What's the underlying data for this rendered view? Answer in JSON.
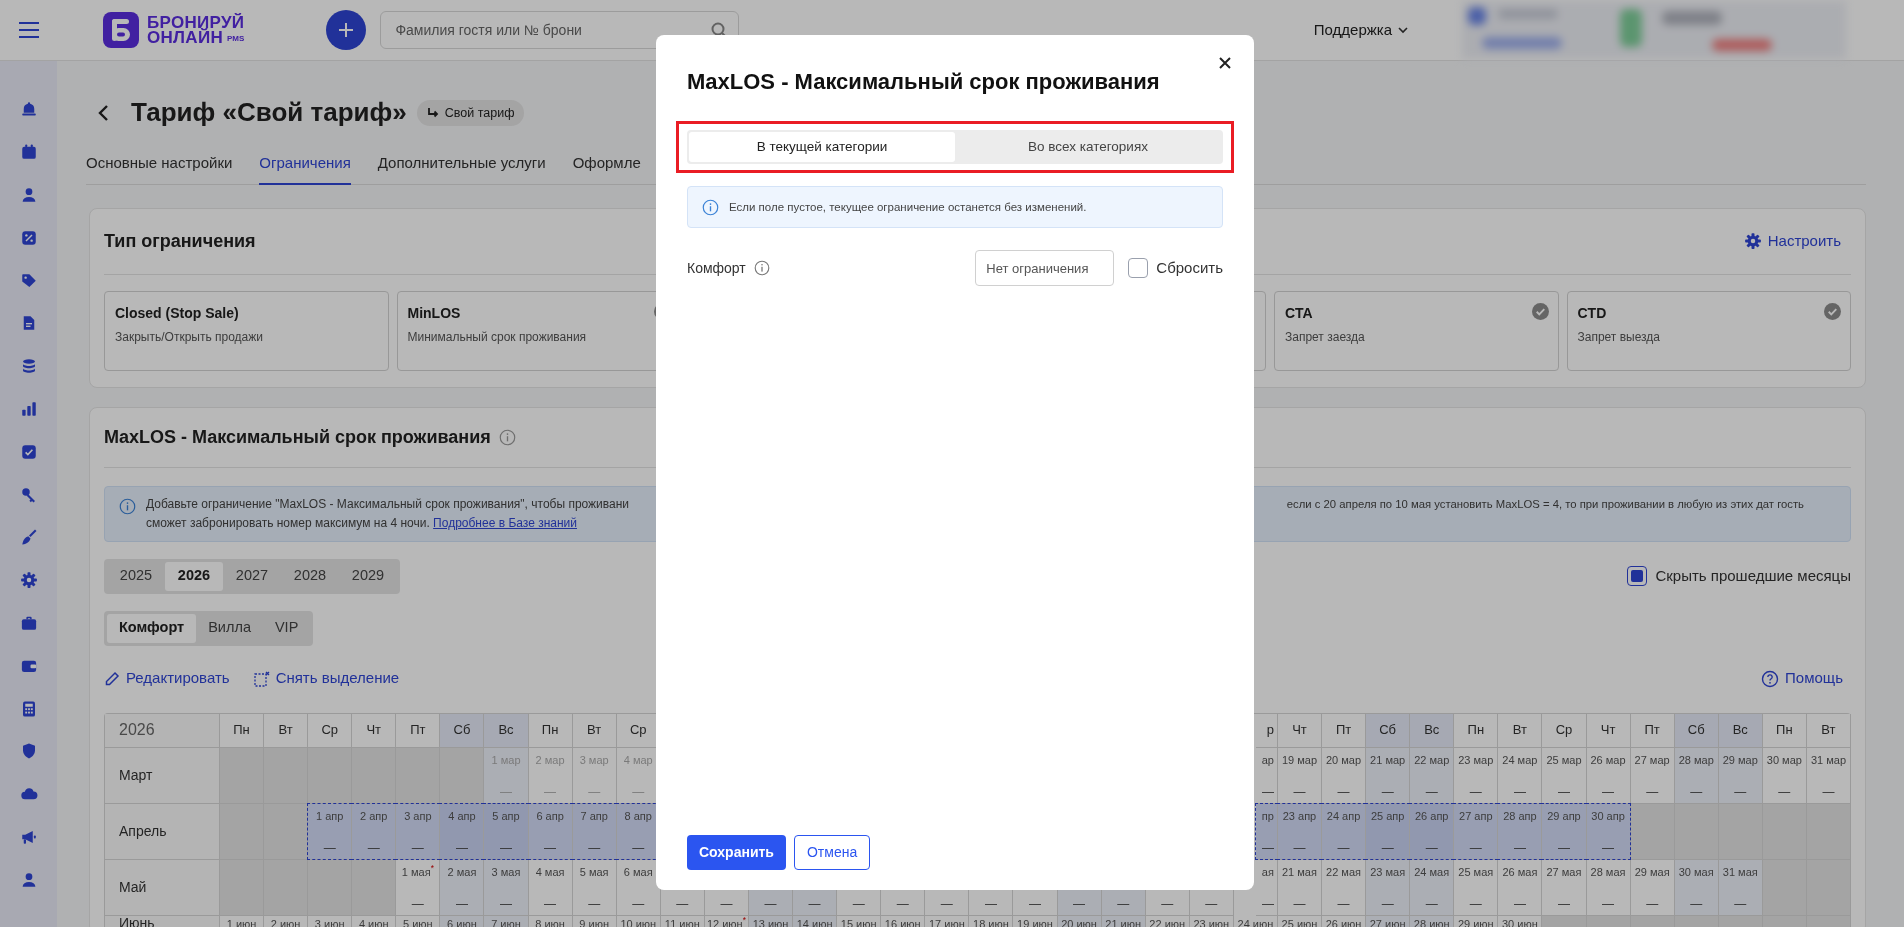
{
  "header": {
    "logo_line1": "БРОНИРУЙ",
    "logo_line2": "ОНЛАЙН",
    "logo_suffix": "PMS",
    "search_placeholder": "Фамилия гостя или № брони",
    "support": "Поддержка"
  },
  "page": {
    "title": "Тариф «Свой тариф»",
    "badge": "Свой тариф"
  },
  "tabs": [
    {
      "label": "Основные настройки",
      "selected": false
    },
    {
      "label": "Ограничения",
      "selected": true
    },
    {
      "label": "Дополнительные услуги",
      "selected": false
    },
    {
      "label": "Оформле",
      "selected": false
    }
  ],
  "restriction_panel": {
    "title": "Тип ограничения",
    "configure": "Настроить",
    "types_left": [
      {
        "name": "Closed (Stop Sale)",
        "description": "Закрыть/Открыть продажи",
        "checked": false
      },
      {
        "name": "MinLOS",
        "description": "Минимальный срок проживания",
        "checked": true
      }
    ],
    "types_right": [
      {
        "name": "CTA",
        "description": "Запрет заезда",
        "checked": true
      },
      {
        "name": "CTD",
        "description": "Запрет выезда",
        "checked": true
      }
    ]
  },
  "maxlos_panel": {
    "title": "MaxLOS - Максимальный срок проживания",
    "info_left_line1": "Добавьте ограничение \"MaxLOS - Максимальный срок проживания\", чтобы проживани",
    "info_left_line2": "сможет забронировать номер максимум на 4 ночи.",
    "info_link": "Подробнее в Базе знаний",
    "info_right_line1": "если с 20 апреля по 10 мая установить MaxLOS = 4, то при проживании в любую из этих дат гость",
    "years": [
      {
        "label": "2025",
        "selected": false
      },
      {
        "label": "2026",
        "selected": true
      },
      {
        "label": "2027",
        "selected": false
      },
      {
        "label": "2028",
        "selected": false
      },
      {
        "label": "2029",
        "selected": false
      }
    ],
    "categories": [
      {
        "label": "Комфорт",
        "selected": true
      },
      {
        "label": "Вилла",
        "selected": false
      },
      {
        "label": "VIP",
        "selected": false
      }
    ],
    "hide_past": {
      "label": "Скрыть прошедшие месяцы",
      "checked": true
    },
    "edit": "Редактировать",
    "clear_selection": "Снять выделение",
    "help": "Помощь",
    "calendar": {
      "year": "2026",
      "headers_left": [
        {
          "text": "Пн",
          "weekend": false
        },
        {
          "text": "Вт",
          "weekend": false
        },
        {
          "text": "Ср",
          "weekend": false
        },
        {
          "text": "Чт",
          "weekend": false
        },
        {
          "text": "Пт",
          "weekend": false
        },
        {
          "text": "Сб",
          "weekend": true
        },
        {
          "text": "Вс",
          "weekend": true
        },
        {
          "text": "Пн",
          "weekend": false
        },
        {
          "text": "Вт",
          "weekend": false
        },
        {
          "text": "Ср",
          "weekend": false
        }
      ],
      "headers_right": [
        {
          "text": "р",
          "weekend": false,
          "kind": "clipped"
        },
        {
          "text": "Чт",
          "weekend": false,
          "kind": "full"
        },
        {
          "text": "Пт",
          "weekend": false,
          "kind": "full"
        },
        {
          "text": "Сб",
          "weekend": true,
          "kind": "full"
        },
        {
          "text": "Вс",
          "weekend": true,
          "kind": "full"
        },
        {
          "text": "Пн",
          "weekend": false,
          "kind": "full"
        },
        {
          "text": "Вт",
          "weekend": false,
          "kind": "full"
        },
        {
          "text": "Ср",
          "weekend": false,
          "kind": "full"
        },
        {
          "text": "Чт",
          "weekend": false,
          "kind": "full"
        },
        {
          "text": "Пт",
          "weekend": false,
          "kind": "full"
        },
        {
          "text": "Сб",
          "weekend": true,
          "kind": "full"
        },
        {
          "text": "Вс",
          "weekend": true,
          "kind": "full"
        },
        {
          "text": "Пн",
          "weekend": false,
          "kind": "full"
        },
        {
          "text": "Вт",
          "weekend": false,
          "kind": "full"
        }
      ],
      "rows": [
        {
          "month": "Март",
          "cells_left": [
            {
              "kind": "blank"
            },
            {
              "kind": "blank"
            },
            {
              "kind": "blank"
            },
            {
              "kind": "blank"
            },
            {
              "kind": "blank"
            },
            {
              "kind": "blank"
            },
            {
              "kind": "day",
              "date": "1 мар",
              "value": "—",
              "past": true,
              "selected": false
            },
            {
              "kind": "day",
              "date": "2 мар",
              "value": "—",
              "past": true,
              "selected": false
            },
            {
              "kind": "day",
              "date": "3 мар",
              "value": "—",
              "past": true,
              "selected": false
            },
            {
              "kind": "day",
              "date": "4 мар",
              "value": "—",
              "past": true,
              "selected": false
            }
          ],
          "cells_right": [
            {
              "kind": "clipped",
              "date": "ар",
              "value": "—",
              "past": false,
              "selected": false
            },
            {
              "kind": "day",
              "date": "19 мар",
              "value": "—",
              "past": false,
              "selected": false
            },
            {
              "kind": "day",
              "date": "20 мар",
              "value": "—",
              "past": false,
              "selected": false
            },
            {
              "kind": "day",
              "date": "21 мар",
              "value": "—",
              "past": false,
              "selected": false
            },
            {
              "kind": "day",
              "date": "22 мар",
              "value": "—",
              "past": false,
              "selected": false
            },
            {
              "kind": "day",
              "date": "23 мар",
              "value": "—",
              "past": false,
              "selected": false
            },
            {
              "kind": "day",
              "date": "24 мар",
              "value": "—",
              "past": false,
              "selected": false
            },
            {
              "kind": "day",
              "date": "25 мар",
              "value": "—",
              "past": false,
              "selected": false
            },
            {
              "kind": "day",
              "date": "26 мар",
              "value": "—",
              "past": false,
              "selected": false
            },
            {
              "kind": "day",
              "date": "27 мар",
              "value": "—",
              "past": false,
              "selected": false
            },
            {
              "kind": "day",
              "date": "28 мар",
              "value": "—",
              "past": false,
              "selected": false
            },
            {
              "kind": "day",
              "date": "29 мар",
              "value": "—",
              "past": false,
              "selected": false
            },
            {
              "kind": "day",
              "date": "30 мар",
              "value": "—",
              "past": false,
              "selected": false
            },
            {
              "kind": "day",
              "date": "31 мар",
              "value": "—",
              "past": false,
              "selected": false
            }
          ]
        },
        {
          "month": "Апрель",
          "cells_left": [
            {
              "kind": "blank"
            },
            {
              "kind": "blank"
            },
            {
              "kind": "day",
              "date": "1 апр",
              "value": "—",
              "past": false,
              "selected": true
            },
            {
              "kind": "day",
              "date": "2 апр",
              "value": "—",
              "past": false,
              "selected": true
            },
            {
              "kind": "day",
              "date": "3 апр",
              "value": "—",
              "past": false,
              "selected": true
            },
            {
              "kind": "day",
              "date": "4 апр",
              "value": "—",
              "past": false,
              "selected": true
            },
            {
              "kind": "day",
              "date": "5 апр",
              "value": "—",
              "past": false,
              "selected": true
            },
            {
              "kind": "day",
              "date": "6 апр",
              "value": "—",
              "past": false,
              "selected": true
            },
            {
              "kind": "day",
              "date": "7 апр",
              "value": "—",
              "past": false,
              "selected": true
            },
            {
              "kind": "day",
              "date": "8 апр",
              "value": "—",
              "past": false,
              "selected": true
            }
          ],
          "cells_right": [
            {
              "kind": "clipped",
              "date": "пр",
              "value": "—",
              "past": false,
              "selected": true
            },
            {
              "kind": "day",
              "date": "23 апр",
              "value": "—",
              "past": false,
              "selected": true
            },
            {
              "kind": "day",
              "date": "24 апр",
              "value": "—",
              "past": false,
              "selected": true
            },
            {
              "kind": "day",
              "date": "25 апр",
              "value": "—",
              "past": false,
              "selected": true
            },
            {
              "kind": "day",
              "date": "26 апр",
              "value": "—",
              "past": false,
              "selected": true
            },
            {
              "kind": "day",
              "date": "27 апр",
              "value": "—",
              "past": false,
              "selected": true
            },
            {
              "kind": "day",
              "date": "28 апр",
              "value": "—",
              "past": false,
              "selected": true
            },
            {
              "kind": "day",
              "date": "29 апр",
              "value": "—",
              "past": false,
              "selected": true
            },
            {
              "kind": "day",
              "date": "30 апр",
              "value": "—",
              "past": false,
              "selected": true
            },
            {
              "kind": "blank"
            },
            {
              "kind": "blank"
            },
            {
              "kind": "blank"
            },
            {
              "kind": "blank"
            },
            {
              "kind": "blank"
            }
          ]
        },
        {
          "month": "Май",
          "cells_left": [
            {
              "kind": "blank"
            },
            {
              "kind": "blank"
            },
            {
              "kind": "blank"
            },
            {
              "kind": "blank"
            },
            {
              "kind": "day",
              "date": "1 мая$^{*}$",
              "value": "—",
              "past": false,
              "selected": false
            },
            {
              "kind": "day",
              "date": "2 мая",
              "value": "—",
              "past": false,
              "selected": false
            },
            {
              "kind": "day",
              "date": "3 мая",
              "value": "—",
              "past": false,
              "selected": false
            },
            {
              "kind": "day",
              "date": "4 мая",
              "value": "—",
              "past": false,
              "selected": false
            },
            {
              "kind": "day",
              "date": "5 мая",
              "value": "—",
              "past": false,
              "selected": false
            },
            {
              "kind": "day",
              "date": "6 мая",
              "value": "—",
              "past": false,
              "selected": false
            }
          ],
          "cells_middle": [
            {
              "kind": "value",
              "value": "—"
            },
            {
              "kind": "value",
              "value": "—"
            },
            {
              "kind": "value",
              "value": "—"
            },
            {
              "kind": "value",
              "value": "—"
            },
            {
              "kind": "value",
              "value": "—"
            },
            {
              "kind": "value",
              "value": "—"
            },
            {
              "kind": "value",
              "value": "—"
            },
            {
              "kind": "value",
              "value": "—"
            },
            {
              "kind": "value",
              "value": "—"
            },
            {
              "kind": "value",
              "value": "—"
            },
            {
              "kind": "value",
              "value": "—"
            },
            {
              "kind": "value",
              "value": "—"
            },
            {
              "kind": "value",
              "value": "—"
            }
          ],
          "cells_right": [
            {
              "kind": "clipped",
              "date": "ая",
              "value": "—",
              "past": false,
              "selected": false
            },
            {
              "kind": "day",
              "date": "21 мая",
              "value": "—",
              "past": false,
              "selected": false
            },
            {
              "kind": "day",
              "date": "22 мая",
              "value": "—",
              "past": false,
              "selected": false
            },
            {
              "kind": "day",
              "date": "23 мая",
              "value": "—",
              "past": false,
              "selected": false
            },
            {
              "kind": "day",
              "date": "24 мая",
              "value": "—",
              "past": false,
              "selected": false
            },
            {
              "kind": "day",
              "date": "25 мая",
              "value": "—",
              "past": false,
              "selected": false
            },
            {
              "kind": "day",
              "date": "26 мая",
              "value": "—",
              "past": false,
              "selected": false
            },
            {
              "kind": "day",
              "date": "27 мая",
              "value": "—",
              "past": false,
              "selected": false
            },
            {
              "kind": "day",
              "date": "28 мая",
              "value": "—",
              "past": false,
              "selected": false
            },
            {
              "kind": "day",
              "date": "29 мая",
              "value": "—",
              "past": false,
              "selected": false
            },
            {
              "kind": "day",
              "date": "30 мая",
              "value": "—",
              "past": false,
              "selected": false
            },
            {
              "kind": "day",
              "date": "31 мая",
              "value": "—",
              "past": false,
              "selected": false
            },
            {
              "kind": "blank"
            },
            {
              "kind": "blank"
            }
          ]
        },
        {
          "month": "Июнь",
          "cells_left": [
            {
              "kind": "day",
              "date": "1 июн",
              "past": false,
              "selected": false
            },
            {
              "kind": "day",
              "date": "2 июн",
              "past": false,
              "selected": false
            },
            {
              "kind": "day",
              "date": "3 июн",
              "past": false,
              "selected": false
            },
            {
              "kind": "day",
              "date": "4 июн",
              "past": false,
              "selected": false
            },
            {
              "kind": "day",
              "date": "5 июн",
              "past": false,
              "selected": false
            },
            {
              "kind": "day",
              "date": "6 июн",
              "past": false,
              "selected": false
            },
            {
              "kind": "day",
              "date": "7 июн",
              "past": false,
              "selected": false
            },
            {
              "kind": "day",
              "date": "8 июн",
              "past": false,
              "selected": false
            },
            {
              "kind": "day",
              "date": "9 июн",
              "past": false,
              "selected": false
            },
            {
              "kind": "day",
              "date": "10 июн",
              "past": false,
              "selected": false
            }
          ],
          "cells_middle": [
            {
              "kind": "day",
              "date": "11 июн",
              "past": false,
              "selected": false
            },
            {
              "kind": "day",
              "date": "12 июн$^{*}$",
              "past": false,
              "selected": false
            },
            {
              "kind": "day",
              "date": "13 июн",
              "past": false,
              "selected": false
            },
            {
              "kind": "day",
              "date": "14 июн",
              "past": false,
              "selected": false
            },
            {
              "kind": "day",
              "date": "15 июн",
              "past": false,
              "selected": false
            },
            {
              "kind": "day",
              "date": "16 июн",
              "past": false,
              "selected": false
            },
            {
              "kind": "day",
              "date": "17 июн",
              "past": false,
              "selected": false
            },
            {
              "kind": "day",
              "date": "18 июн",
              "past": false,
              "selected": false
            },
            {
              "kind": "day",
              "date": "19 июн",
              "past": false,
              "selected": false
            },
            {
              "kind": "day",
              "date": "20 июн",
              "past": false,
              "selected": false
            },
            {
              "kind": "day",
              "date": "21 июн",
              "past": false,
              "selected": false
            },
            {
              "kind": "day",
              "date": "22 июн",
              "past": false,
              "selected": false
            },
            {
              "kind": "day",
              "date": "23 июн",
              "past": false,
              "selected": false
            }
          ],
          "cells_right": [
            {
              "kind": "day",
              "date": "24 июн",
              "past": false,
              "selected": false
            },
            {
              "kind": "day",
              "date": "25 июн",
              "past": false,
              "selected": false
            },
            {
              "kind": "day",
              "date": "26 июн",
              "past": false,
              "selected": false
            },
            {
              "kind": "day",
              "date": "27 июн",
              "past": false,
              "selected": false
            },
            {
              "kind": "day",
              "date": "28 июн",
              "past": false,
              "selected": false
            },
            {
              "kind": "day",
              "date": "29 июн",
              "past": false,
              "selected": false
            },
            {
              "kind": "day",
              "date": "30 июн",
              "past": false,
              "selected": false
            },
            {
              "kind": "blank"
            },
            {
              "kind": "blank"
            },
            {
              "kind": "blank"
            },
            {
              "kind": "blank"
            },
            {
              "kind": "blank"
            },
            {
              "kind": "blank"
            },
            {
              "kind": "blank"
            }
          ]
        }
      ]
    }
  },
  "dialog": {
    "title": "MaxLOS - Максимальный срок проживания",
    "scopes": [
      {
        "label": "В текущей категории",
        "selected": true
      },
      {
        "label": "Во всех категориях",
        "selected": false
      }
    ],
    "note": "Если поле пустое, текущее ограничение останется без изменений.",
    "fields": [
      {
        "label": "Комфорт",
        "placeholder": "Нет ограничения",
        "reset_label": "Сбросить",
        "reset_checked": false
      }
    ],
    "save": "Сохранить",
    "cancel": "Отмена"
  }
}
